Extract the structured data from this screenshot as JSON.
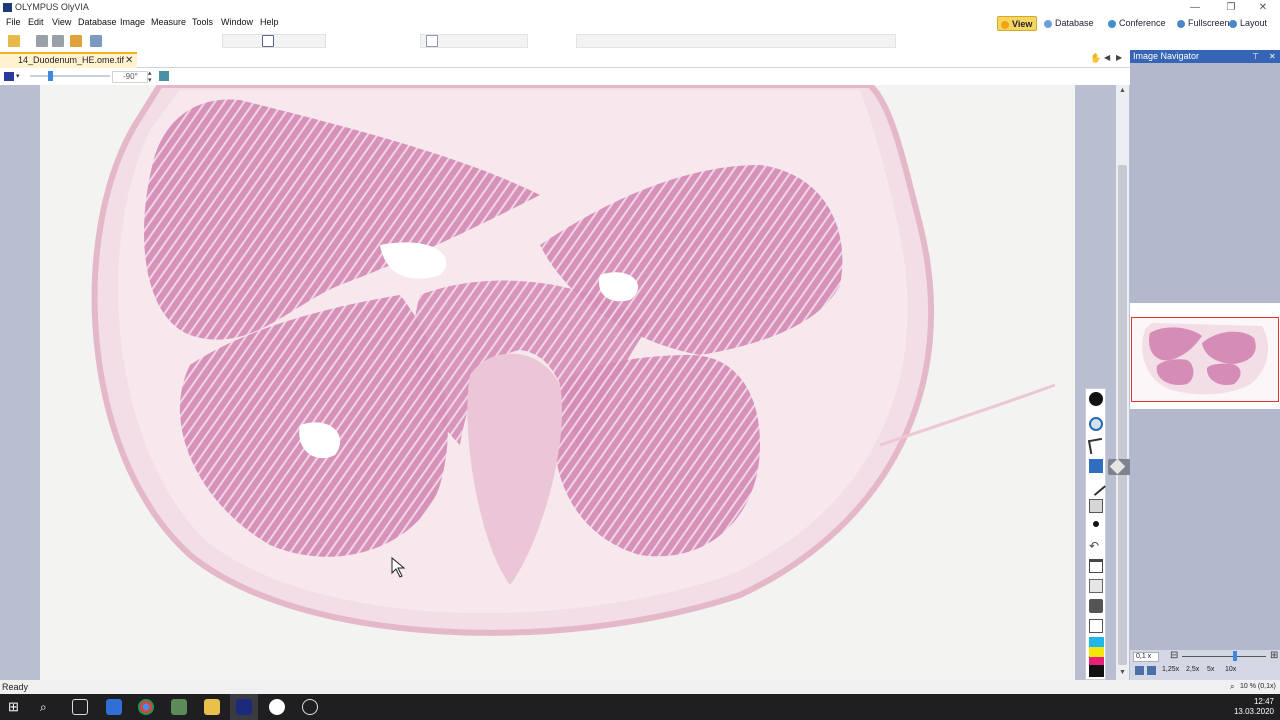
{
  "window": {
    "title": "OLYMPUS OlyVIA"
  },
  "menu": [
    "File",
    "Edit",
    "View",
    "Database",
    "Image",
    "Measure",
    "Tools",
    "Window",
    "Help"
  ],
  "mode_buttons": [
    {
      "label": "View",
      "color": "#f1a418"
    },
    {
      "label": "Database",
      "color": "#6aa0d8"
    },
    {
      "label": "Conference",
      "color": "#3d8fd1"
    },
    {
      "label": "Fullscreen",
      "color": "#4a86c8"
    },
    {
      "label": "Layout",
      "color": "#4a86c8"
    }
  ],
  "document_tab": {
    "label": "14_Duodenum_HE.ome.tif"
  },
  "image_controls": {
    "rotation": "-90°"
  },
  "navigator": {
    "title": "Image Navigator",
    "zoom_value": "0,1 x",
    "zoom_presets": [
      "1,25x",
      "2,5x",
      "5x",
      "10x"
    ]
  },
  "annotation_tools": {
    "text_tool_label": "A"
  },
  "status": {
    "text": "Ready",
    "zoom_info": "10 % (0,1x)"
  },
  "clock": {
    "time": "12:47",
    "date": "13.03.2020"
  },
  "colors": {
    "accent_yellow": "#f2b31c",
    "nav_title_blue": "#3565b4",
    "tissue_pink": "#d98bb5",
    "navigator_border_red": "#e0332f"
  }
}
